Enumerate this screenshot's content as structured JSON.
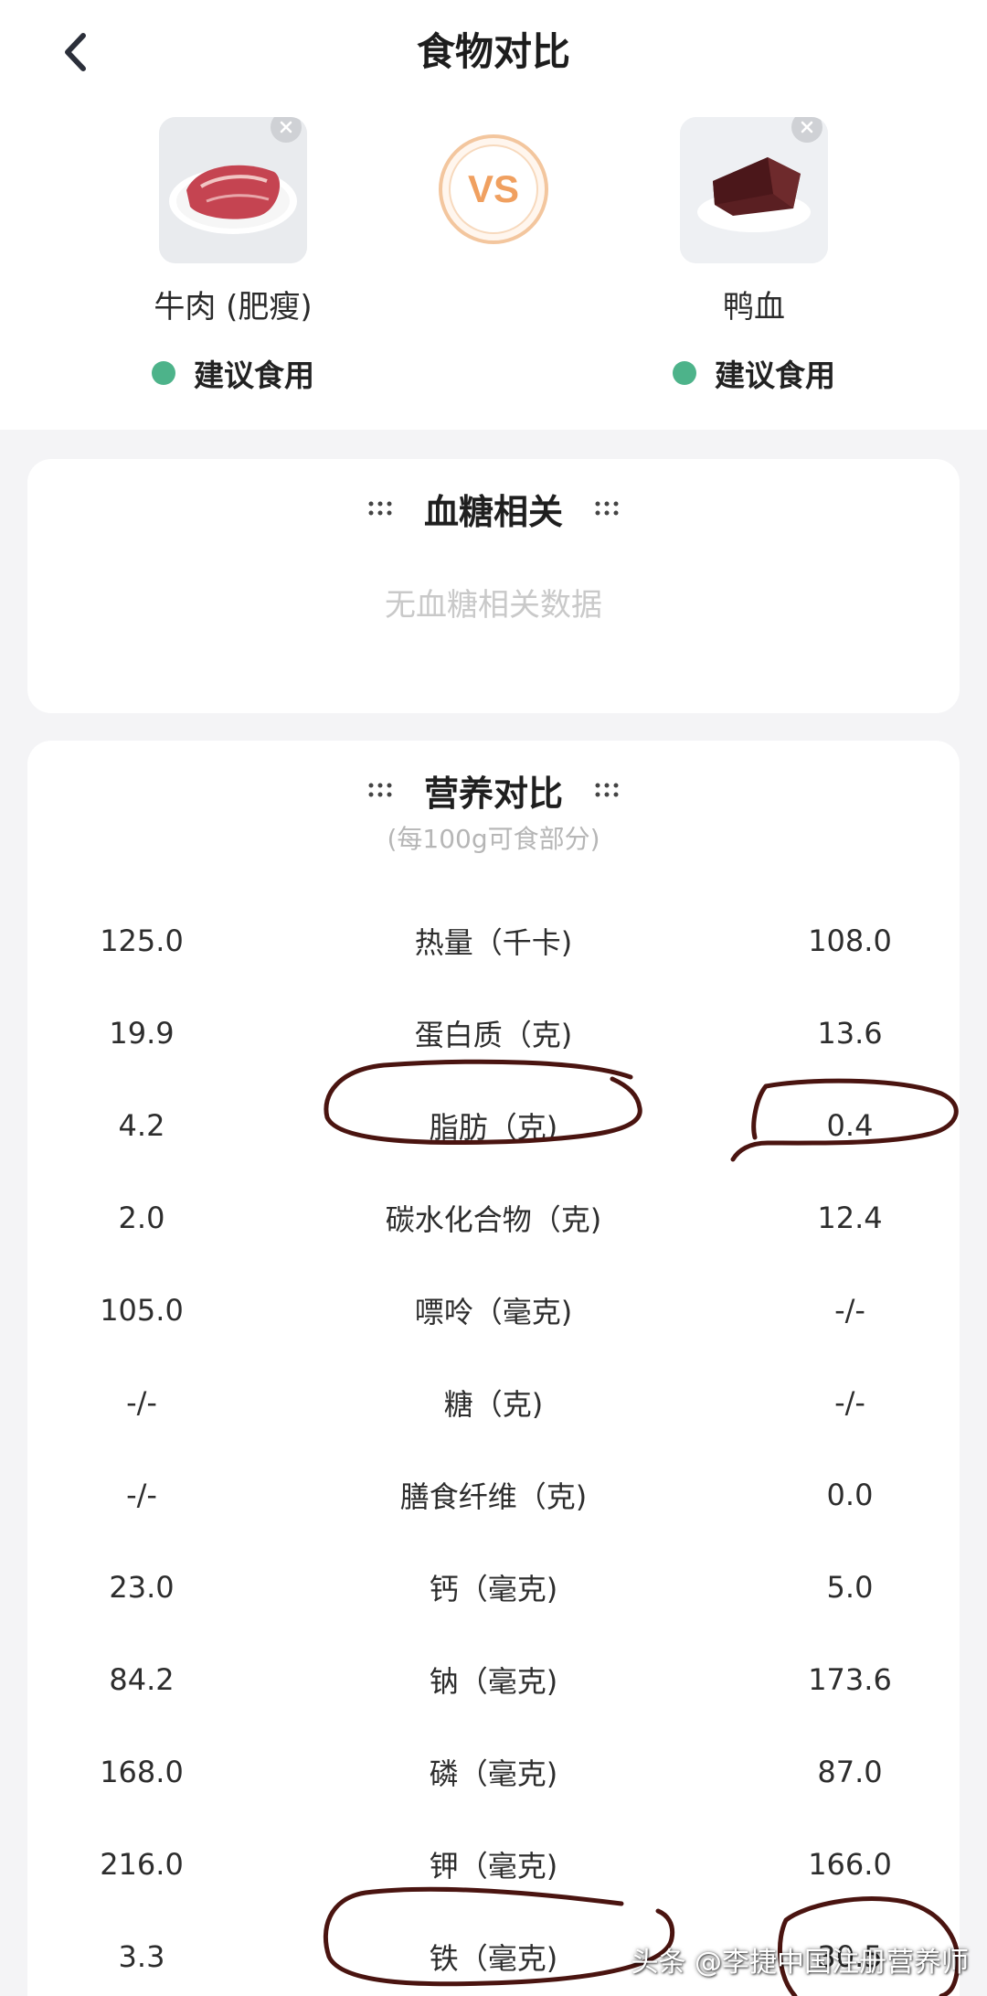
{
  "header": {
    "title": "食物对比",
    "back_icon": "chevron-left-icon"
  },
  "foods": [
    {
      "name": "牛肉 (肥瘦)",
      "status": "建议食用",
      "status_color": "#4db38a"
    },
    {
      "name": "鸭血",
      "status": "建议食用",
      "status_color": "#4db38a"
    }
  ],
  "vs_label": "VS",
  "glucose": {
    "title": "血糖相关",
    "empty": "无血糖相关数据"
  },
  "nutrition": {
    "title": "营养对比",
    "subtitle": "(每100g可食部分)",
    "rows": [
      {
        "a": "125.0",
        "name": "热量（千卡)",
        "b": "108.0"
      },
      {
        "a": "19.9",
        "name": "蛋白质（克)",
        "b": "13.6"
      },
      {
        "a": "4.2",
        "name": "脂肪（克)",
        "b": "0.4"
      },
      {
        "a": "2.0",
        "name": "碳水化合物（克)",
        "b": "12.4"
      },
      {
        "a": "105.0",
        "name": "嘌呤（毫克)",
        "b": "-/-"
      },
      {
        "a": "-/-",
        "name": "糖（克)",
        "b": "-/-"
      },
      {
        "a": "-/-",
        "name": "膳食纤维（克)",
        "b": "0.0"
      },
      {
        "a": "23.0",
        "name": "钙（毫克)",
        "b": "5.0"
      },
      {
        "a": "84.2",
        "name": "钠（毫克)",
        "b": "173.6"
      },
      {
        "a": "168.0",
        "name": "磷（毫克)",
        "b": "87.0"
      },
      {
        "a": "216.0",
        "name": "钾（毫克)",
        "b": "166.0"
      },
      {
        "a": "3.3",
        "name": "铁（毫克)",
        "b": "30.5"
      }
    ]
  },
  "watermark": "头条 @李捷中国注册营养师",
  "colors": {
    "accent_orange": "#f0a060",
    "annotation_ink": "#4a1410",
    "status_green": "#4db38a"
  }
}
